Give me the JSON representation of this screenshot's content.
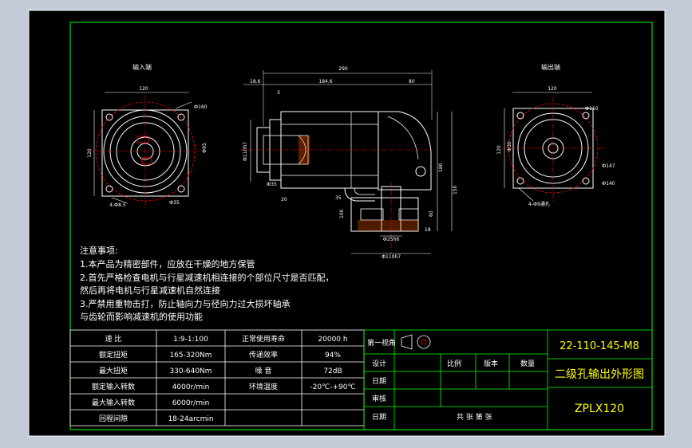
{
  "views": {
    "input_title": "输入端",
    "output_title": "输出端",
    "input_dims": {
      "width": "120",
      "height": "120",
      "pcd": "Ф160",
      "face": "Ф95",
      "bolt": "4-Ф8.5",
      "key": "Ф35"
    },
    "side_dims": {
      "total": "290",
      "left": "18.6",
      "mid": "184.6",
      "right": "80",
      "flange": "3",
      "bore": "Ф110h7",
      "shaft": "Ф35",
      "h150": "150",
      "h180": "180",
      "h60": "60",
      "h18": "18",
      "h100": "100",
      "base1": "Ф25h6",
      "base2": "Ф110h7",
      "n20": "20",
      "n35": "35"
    },
    "output_dims": {
      "width": "120",
      "height": "120",
      "pcd": "Ф147",
      "face": "Ф140",
      "bolt": "4-Ф9通孔",
      "d30": "Ф30",
      "d110": "Ф110"
    }
  },
  "notes": {
    "heading": "注意事项:",
    "lines": [
      "1.本产品为精密部件，应放在干燥的地方保管",
      "2.首先严格检查电机与行星减速机相连接的个部位尺寸是否匹配，",
      "然后再将电机与行星减速机自然连接",
      "3.严禁用重物击打，防止轴向力与径向力过大损坏轴承",
      "与齿轮而影响减速机的使用功能"
    ]
  },
  "specs": {
    "rows": [
      {
        "label": "速  比",
        "value": "1:9-1:100",
        "label2": "正常使用寿命",
        "value2": "20000 h"
      },
      {
        "label": "额定扭矩",
        "value": "165-320Nm",
        "label2": "传递效率",
        "value2": "94%"
      },
      {
        "label": "最大扭矩",
        "value": "330-640Nm",
        "label2": "噪  音",
        "value2": "72dB"
      },
      {
        "label": "额定输入转数",
        "value": "4000r/min",
        "label2": "环境温度",
        "value2": "-20℃-+90℃"
      },
      {
        "label": "最大输入转数",
        "value": "6000r/min",
        "label2": "",
        "value2": ""
      },
      {
        "label": "回程间隙",
        "value": "18-24arcmin",
        "label2": "",
        "value2": ""
      }
    ]
  },
  "title_block": {
    "projection_label": "第一视角",
    "design": "设计",
    "check": "审核",
    "date1": "日期",
    "approve": "审核",
    "date2": "日期",
    "scale": "比例",
    "version": "版本",
    "quantity": "数量",
    "sheets": "共  张  第  张",
    "drawing_no": "22-110-145-M8",
    "drawing_title": "二级孔输出外形图",
    "model": "ZPLX120"
  },
  "colors": {
    "background": "#000000",
    "frame": "#ffffff",
    "border": "#00ff00",
    "part": "#ffffff",
    "dimension": "#ff0000",
    "text": "#ffffff",
    "title": "#ffff00"
  }
}
